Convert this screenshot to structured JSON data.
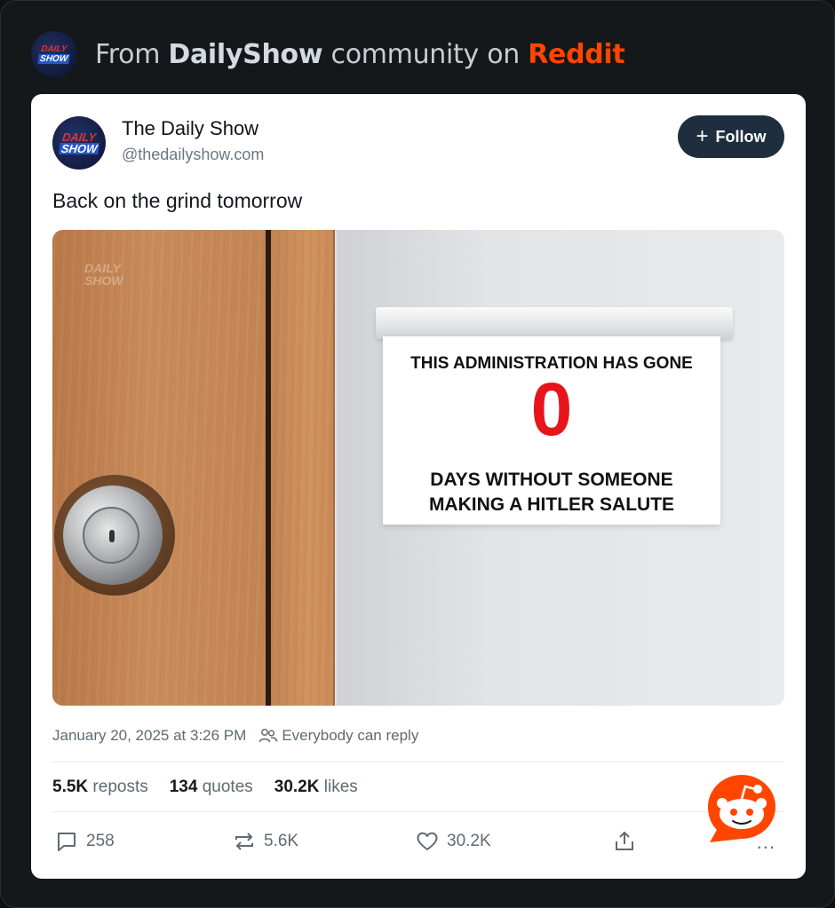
{
  "header": {
    "prefix": "From",
    "community": "DailyShow",
    "middle": "community on",
    "platform": "Reddit"
  },
  "post": {
    "author_name": "The Daily Show",
    "author_handle": "@thedailyshow.com",
    "follow_label": "Follow",
    "text": "Back on the grind tomorrow",
    "image": {
      "watermark_line1": "DAILY",
      "watermark_line2": "SHOW",
      "sign_line1": "THIS ADMINISTRATION HAS GONE",
      "sign_count": "0",
      "sign_line2a": "DAYS WITHOUT SOMEONE",
      "sign_line2b": "MAKING A HITLER SALUTE"
    },
    "timestamp": "January 20, 2025 at 3:26 PM",
    "reply_setting": "Everybody can reply",
    "stats": {
      "reposts_count": "5.5K",
      "reposts_label": "reposts",
      "quotes_count": "134",
      "quotes_label": "quotes",
      "likes_count": "30.2K",
      "likes_label": "likes"
    },
    "actions": {
      "replies": "258",
      "reposts": "5.6K",
      "likes": "30.2K",
      "more": "..."
    }
  },
  "logo": {
    "daily": "DAILY",
    "show": "SHOW"
  },
  "colors": {
    "reddit_orange": "#ff4500",
    "follow_bg": "#1e2e3e",
    "sign_number": "#e8141c"
  },
  "icons": [
    "people-icon",
    "reply-icon",
    "repost-icon",
    "heart-icon",
    "share-icon",
    "reddit-snoo-icon"
  ]
}
